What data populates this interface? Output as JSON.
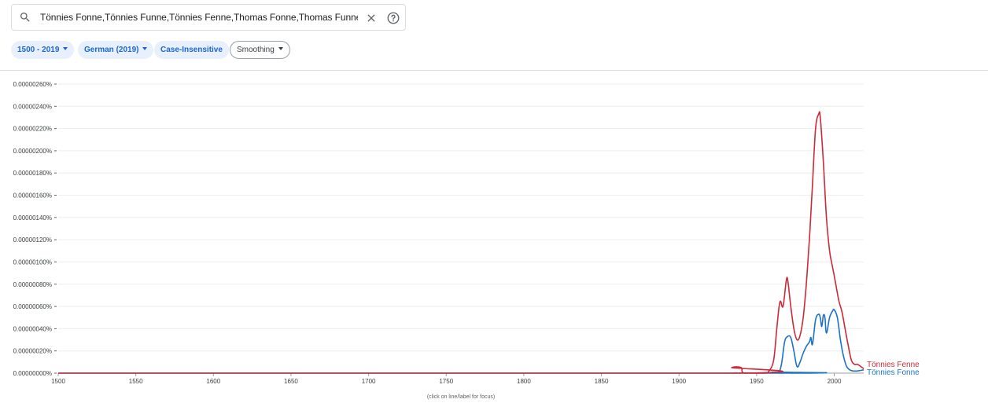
{
  "search": {
    "query": "Tönnies Fonne,Tönnies Funne,Tönnies Fenne,Thomas Fonne,Thomas Funne,Thom",
    "search_icon": "search-icon",
    "clear_icon": "close-icon",
    "help_icon": "help-circle-icon"
  },
  "filters": {
    "year_range": "1500 - 2019",
    "corpus": "German (2019)",
    "case": "Case-Insensitive",
    "smoothing": "Smoothing"
  },
  "footnote": "(click on line/label for focus)",
  "colors": {
    "red": "#cc2a36",
    "blue": "#1a73c8",
    "grid": "#eeeeee",
    "axis": "#9aa0a6"
  },
  "chart_data": {
    "type": "line",
    "x_range": [
      1500,
      2019
    ],
    "x_ticks": [
      "1500",
      "1550",
      "1600",
      "1650",
      "1700",
      "1750",
      "1800",
      "1850",
      "1900",
      "1950",
      "2000"
    ],
    "y_ticks": [
      "0.00000000%",
      "0.00000020%",
      "0.00000040%",
      "0.00000060%",
      "0.00000080%",
      "0.00000100%",
      "0.00000120%",
      "0.00000140%",
      "0.00000160%",
      "0.00000180%",
      "0.00000200%",
      "0.00000220%",
      "0.00000240%",
      "0.00000260%"
    ],
    "y_range": [
      0,
      2.6e-06
    ],
    "series": [
      {
        "name": "Tönnies Fenne",
        "color": "#cc2a36",
        "points": [
          [
            1500,
            0
          ],
          [
            1932,
            0
          ],
          [
            1934,
            5e-08
          ],
          [
            1940,
            5e-08
          ],
          [
            1942,
            0
          ],
          [
            1955,
            0
          ],
          [
            1958,
            2e-08
          ],
          [
            1961,
            1.2e-07
          ],
          [
            1963,
            4e-07
          ],
          [
            1965,
            6.4e-07
          ],
          [
            1967,
            6e-07
          ],
          [
            1969,
            8.2e-07
          ],
          [
            1970,
            8.4e-07
          ],
          [
            1972,
            6e-07
          ],
          [
            1974,
            4e-07
          ],
          [
            1976,
            3e-07
          ],
          [
            1978,
            3.4e-07
          ],
          [
            1980,
            5e-07
          ],
          [
            1982,
            8e-07
          ],
          [
            1984,
            1.2e-06
          ],
          [
            1986,
            1.7e-06
          ],
          [
            1988,
            2.2e-06
          ],
          [
            1990,
            2.33e-06
          ],
          [
            1991,
            2.3e-06
          ],
          [
            1993,
            1.9e-06
          ],
          [
            1995,
            1.4e-06
          ],
          [
            1997,
            1.1e-06
          ],
          [
            1999,
            9.5e-07
          ],
          [
            2001,
            8e-07
          ],
          [
            2003,
            6.5e-07
          ],
          [
            2005,
            5.5e-07
          ],
          [
            2007,
            4e-07
          ],
          [
            2009,
            2.5e-07
          ],
          [
            2011,
            1.2e-07
          ],
          [
            2013,
            8e-08
          ],
          [
            2015,
            8e-08
          ],
          [
            2017,
            6e-08
          ],
          [
            2019,
            4e-08
          ]
        ]
      },
      {
        "name": "Tönnies Fonne",
        "color": "#1a73c8",
        "points": [
          [
            1500,
            0
          ],
          [
            1958,
            0
          ],
          [
            1960,
            1e-08
          ],
          [
            1964,
            1e-08
          ],
          [
            1966,
            8e-08
          ],
          [
            1968,
            2.8e-07
          ],
          [
            1970,
            3.3e-07
          ],
          [
            1972,
            3.2e-07
          ],
          [
            1974,
            2e-07
          ],
          [
            1976,
            6e-08
          ],
          [
            1978,
            1e-07
          ],
          [
            1980,
            1.8e-07
          ],
          [
            1982,
            2.4e-07
          ],
          [
            1984,
            2.8e-07
          ],
          [
            1985,
            3.2e-07
          ],
          [
            1986,
            2.6e-07
          ],
          [
            1988,
            4.8e-07
          ],
          [
            1990,
            5.3e-07
          ],
          [
            1991,
            5e-07
          ],
          [
            1992,
            4.2e-07
          ],
          [
            1993,
            5.2e-07
          ],
          [
            1994,
            5e-07
          ],
          [
            1995,
            3.6e-07
          ],
          [
            1997,
            5e-07
          ],
          [
            1999,
            5.6e-07
          ],
          [
            2000,
            5.7e-07
          ],
          [
            2002,
            5e-07
          ],
          [
            2004,
            3e-07
          ],
          [
            2006,
            1.5e-07
          ],
          [
            2008,
            6e-08
          ],
          [
            2010,
            3e-08
          ],
          [
            2012,
            2e-08
          ],
          [
            2015,
            2e-08
          ],
          [
            2019,
            3e-08
          ]
        ]
      }
    ]
  }
}
